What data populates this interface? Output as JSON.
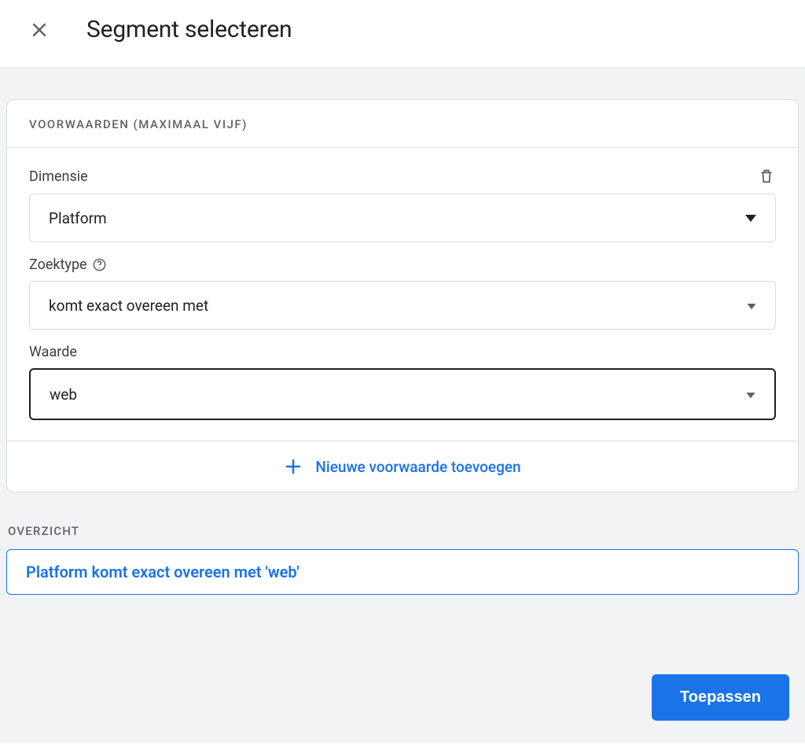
{
  "header": {
    "title": "Segment selecteren"
  },
  "card": {
    "header": "VOORWAARDEN (MAXIMAAL VIJF)"
  },
  "fields": {
    "dimension": {
      "label": "Dimensie",
      "value": "Platform"
    },
    "matchtype": {
      "label": "Zoektype",
      "value": "komt exact overeen met"
    },
    "value": {
      "label": "Waarde",
      "value": "web"
    }
  },
  "addCondition": "Nieuwe voorwaarde toevoegen",
  "overview": {
    "label": "OVERZICHT",
    "summary": "Platform komt exact overeen met 'web'"
  },
  "apply": "Toepassen"
}
